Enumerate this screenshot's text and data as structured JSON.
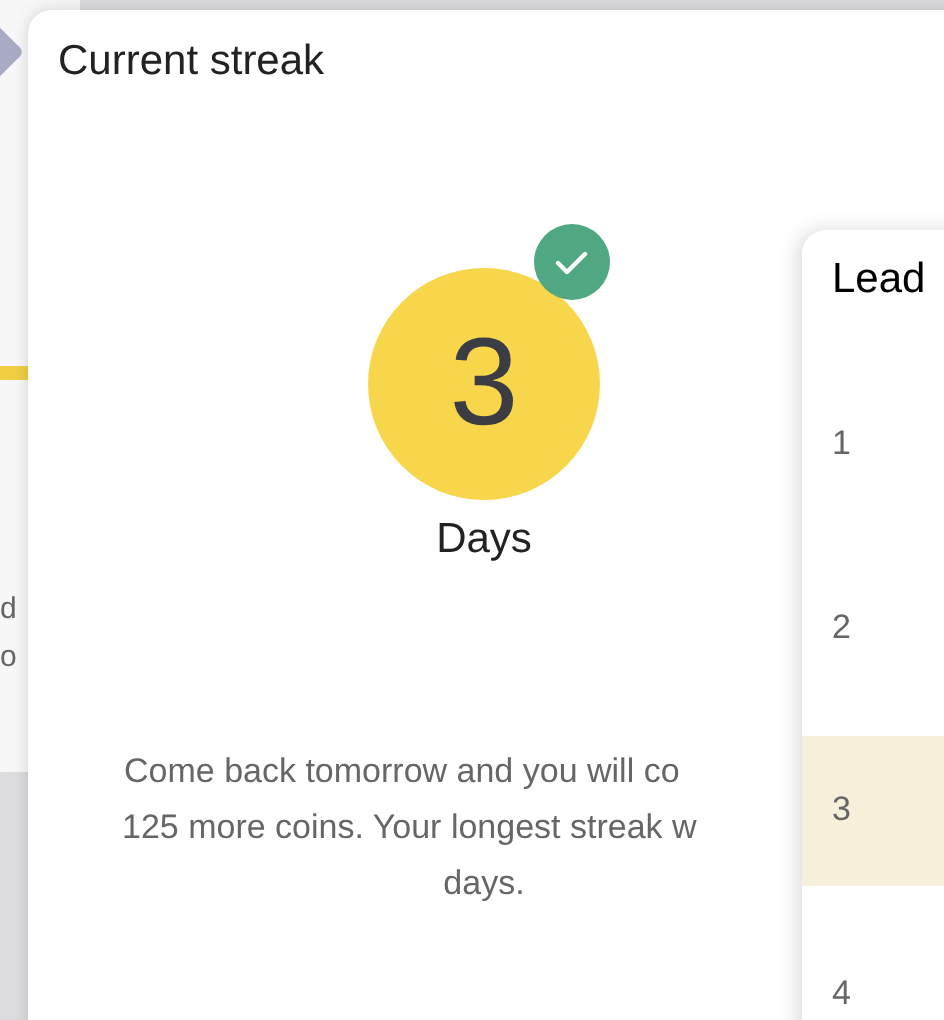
{
  "back_panel": {
    "text_lines": [
      "d",
      "o"
    ]
  },
  "streak_card": {
    "title": "Current streak",
    "count": "3",
    "unit": "Days",
    "completed_today": true,
    "message_lines": [
      "Come back tomorrow and you will co",
      "125 more coins. Your longest streak w",
      "days."
    ]
  },
  "leaderboard": {
    "title": "Lead",
    "rows": [
      {
        "rank": "1",
        "selected": false
      },
      {
        "rank": "2",
        "selected": false
      },
      {
        "rank": "3",
        "selected": true
      },
      {
        "rank": "4",
        "selected": false
      }
    ]
  }
}
